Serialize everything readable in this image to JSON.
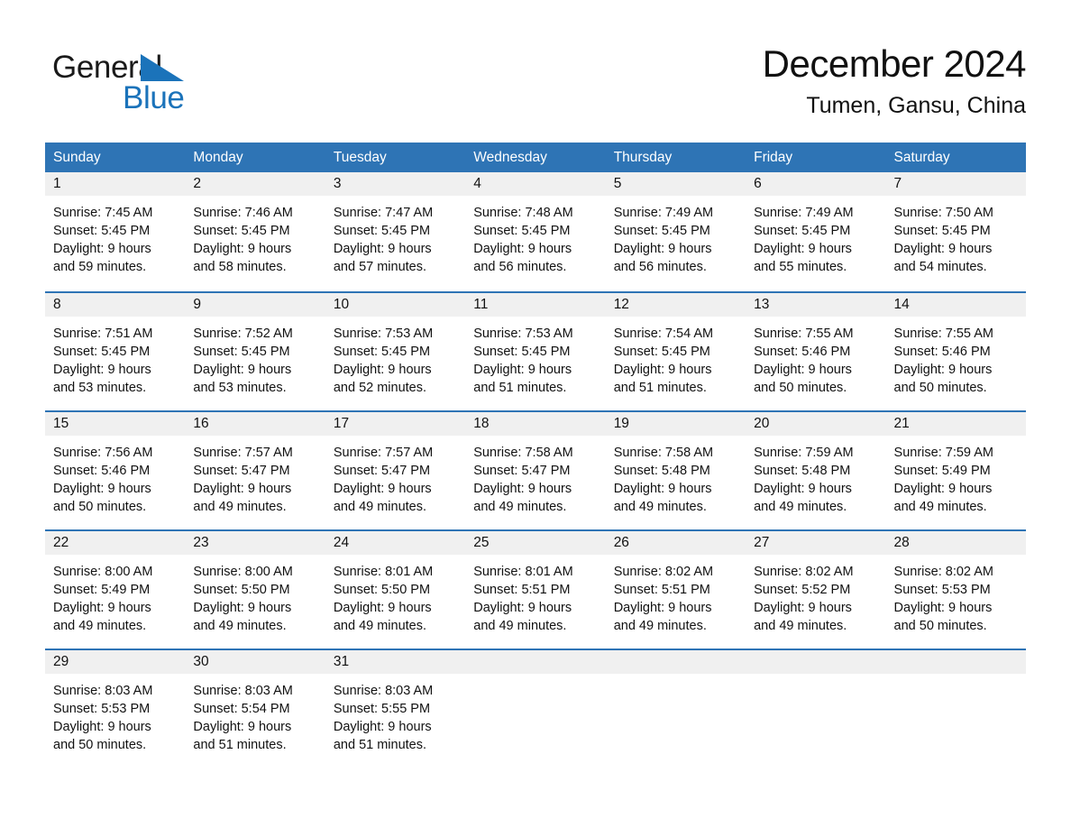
{
  "brand": {
    "name_top": "General",
    "name_bottom": "Blue",
    "accent_color": "#1b73ba",
    "logo_icon": "triangle-flag-icon"
  },
  "header": {
    "title": "December 2024",
    "subtitle": "Tumen, Gansu, China"
  },
  "theme": {
    "header_blue": "#2e74b5",
    "day_band_gray": "#f0f0f0",
    "text_color": "#111111"
  },
  "calendar": {
    "weekdays": [
      "Sunday",
      "Monday",
      "Tuesday",
      "Wednesday",
      "Thursday",
      "Friday",
      "Saturday"
    ],
    "weeks": [
      [
        {
          "day": "1",
          "sunrise": "Sunrise: 7:45 AM",
          "sunset": "Sunset: 5:45 PM",
          "daylight1": "Daylight: 9 hours",
          "daylight2": "and 59 minutes."
        },
        {
          "day": "2",
          "sunrise": "Sunrise: 7:46 AM",
          "sunset": "Sunset: 5:45 PM",
          "daylight1": "Daylight: 9 hours",
          "daylight2": "and 58 minutes."
        },
        {
          "day": "3",
          "sunrise": "Sunrise: 7:47 AM",
          "sunset": "Sunset: 5:45 PM",
          "daylight1": "Daylight: 9 hours",
          "daylight2": "and 57 minutes."
        },
        {
          "day": "4",
          "sunrise": "Sunrise: 7:48 AM",
          "sunset": "Sunset: 5:45 PM",
          "daylight1": "Daylight: 9 hours",
          "daylight2": "and 56 minutes."
        },
        {
          "day": "5",
          "sunrise": "Sunrise: 7:49 AM",
          "sunset": "Sunset: 5:45 PM",
          "daylight1": "Daylight: 9 hours",
          "daylight2": "and 56 minutes."
        },
        {
          "day": "6",
          "sunrise": "Sunrise: 7:49 AM",
          "sunset": "Sunset: 5:45 PM",
          "daylight1": "Daylight: 9 hours",
          "daylight2": "and 55 minutes."
        },
        {
          "day": "7",
          "sunrise": "Sunrise: 7:50 AM",
          "sunset": "Sunset: 5:45 PM",
          "daylight1": "Daylight: 9 hours",
          "daylight2": "and 54 minutes."
        }
      ],
      [
        {
          "day": "8",
          "sunrise": "Sunrise: 7:51 AM",
          "sunset": "Sunset: 5:45 PM",
          "daylight1": "Daylight: 9 hours",
          "daylight2": "and 53 minutes."
        },
        {
          "day": "9",
          "sunrise": "Sunrise: 7:52 AM",
          "sunset": "Sunset: 5:45 PM",
          "daylight1": "Daylight: 9 hours",
          "daylight2": "and 53 minutes."
        },
        {
          "day": "10",
          "sunrise": "Sunrise: 7:53 AM",
          "sunset": "Sunset: 5:45 PM",
          "daylight1": "Daylight: 9 hours",
          "daylight2": "and 52 minutes."
        },
        {
          "day": "11",
          "sunrise": "Sunrise: 7:53 AM",
          "sunset": "Sunset: 5:45 PM",
          "daylight1": "Daylight: 9 hours",
          "daylight2": "and 51 minutes."
        },
        {
          "day": "12",
          "sunrise": "Sunrise: 7:54 AM",
          "sunset": "Sunset: 5:45 PM",
          "daylight1": "Daylight: 9 hours",
          "daylight2": "and 51 minutes."
        },
        {
          "day": "13",
          "sunrise": "Sunrise: 7:55 AM",
          "sunset": "Sunset: 5:46 PM",
          "daylight1": "Daylight: 9 hours",
          "daylight2": "and 50 minutes."
        },
        {
          "day": "14",
          "sunrise": "Sunrise: 7:55 AM",
          "sunset": "Sunset: 5:46 PM",
          "daylight1": "Daylight: 9 hours",
          "daylight2": "and 50 minutes."
        }
      ],
      [
        {
          "day": "15",
          "sunrise": "Sunrise: 7:56 AM",
          "sunset": "Sunset: 5:46 PM",
          "daylight1": "Daylight: 9 hours",
          "daylight2": "and 50 minutes."
        },
        {
          "day": "16",
          "sunrise": "Sunrise: 7:57 AM",
          "sunset": "Sunset: 5:47 PM",
          "daylight1": "Daylight: 9 hours",
          "daylight2": "and 49 minutes."
        },
        {
          "day": "17",
          "sunrise": "Sunrise: 7:57 AM",
          "sunset": "Sunset: 5:47 PM",
          "daylight1": "Daylight: 9 hours",
          "daylight2": "and 49 minutes."
        },
        {
          "day": "18",
          "sunrise": "Sunrise: 7:58 AM",
          "sunset": "Sunset: 5:47 PM",
          "daylight1": "Daylight: 9 hours",
          "daylight2": "and 49 minutes."
        },
        {
          "day": "19",
          "sunrise": "Sunrise: 7:58 AM",
          "sunset": "Sunset: 5:48 PM",
          "daylight1": "Daylight: 9 hours",
          "daylight2": "and 49 minutes."
        },
        {
          "day": "20",
          "sunrise": "Sunrise: 7:59 AM",
          "sunset": "Sunset: 5:48 PM",
          "daylight1": "Daylight: 9 hours",
          "daylight2": "and 49 minutes."
        },
        {
          "day": "21",
          "sunrise": "Sunrise: 7:59 AM",
          "sunset": "Sunset: 5:49 PM",
          "daylight1": "Daylight: 9 hours",
          "daylight2": "and 49 minutes."
        }
      ],
      [
        {
          "day": "22",
          "sunrise": "Sunrise: 8:00 AM",
          "sunset": "Sunset: 5:49 PM",
          "daylight1": "Daylight: 9 hours",
          "daylight2": "and 49 minutes."
        },
        {
          "day": "23",
          "sunrise": "Sunrise: 8:00 AM",
          "sunset": "Sunset: 5:50 PM",
          "daylight1": "Daylight: 9 hours",
          "daylight2": "and 49 minutes."
        },
        {
          "day": "24",
          "sunrise": "Sunrise: 8:01 AM",
          "sunset": "Sunset: 5:50 PM",
          "daylight1": "Daylight: 9 hours",
          "daylight2": "and 49 minutes."
        },
        {
          "day": "25",
          "sunrise": "Sunrise: 8:01 AM",
          "sunset": "Sunset: 5:51 PM",
          "daylight1": "Daylight: 9 hours",
          "daylight2": "and 49 minutes."
        },
        {
          "day": "26",
          "sunrise": "Sunrise: 8:02 AM",
          "sunset": "Sunset: 5:51 PM",
          "daylight1": "Daylight: 9 hours",
          "daylight2": "and 49 minutes."
        },
        {
          "day": "27",
          "sunrise": "Sunrise: 8:02 AM",
          "sunset": "Sunset: 5:52 PM",
          "daylight1": "Daylight: 9 hours",
          "daylight2": "and 49 minutes."
        },
        {
          "day": "28",
          "sunrise": "Sunrise: 8:02 AM",
          "sunset": "Sunset: 5:53 PM",
          "daylight1": "Daylight: 9 hours",
          "daylight2": "and 50 minutes."
        }
      ],
      [
        {
          "day": "29",
          "sunrise": "Sunrise: 8:03 AM",
          "sunset": "Sunset: 5:53 PM",
          "daylight1": "Daylight: 9 hours",
          "daylight2": "and 50 minutes."
        },
        {
          "day": "30",
          "sunrise": "Sunrise: 8:03 AM",
          "sunset": "Sunset: 5:54 PM",
          "daylight1": "Daylight: 9 hours",
          "daylight2": "and 51 minutes."
        },
        {
          "day": "31",
          "sunrise": "Sunrise: 8:03 AM",
          "sunset": "Sunset: 5:55 PM",
          "daylight1": "Daylight: 9 hours",
          "daylight2": "and 51 minutes."
        },
        {
          "day": "",
          "sunrise": "",
          "sunset": "",
          "daylight1": "",
          "daylight2": ""
        },
        {
          "day": "",
          "sunrise": "",
          "sunset": "",
          "daylight1": "",
          "daylight2": ""
        },
        {
          "day": "",
          "sunrise": "",
          "sunset": "",
          "daylight1": "",
          "daylight2": ""
        },
        {
          "day": "",
          "sunrise": "",
          "sunset": "",
          "daylight1": "",
          "daylight2": ""
        }
      ]
    ]
  }
}
